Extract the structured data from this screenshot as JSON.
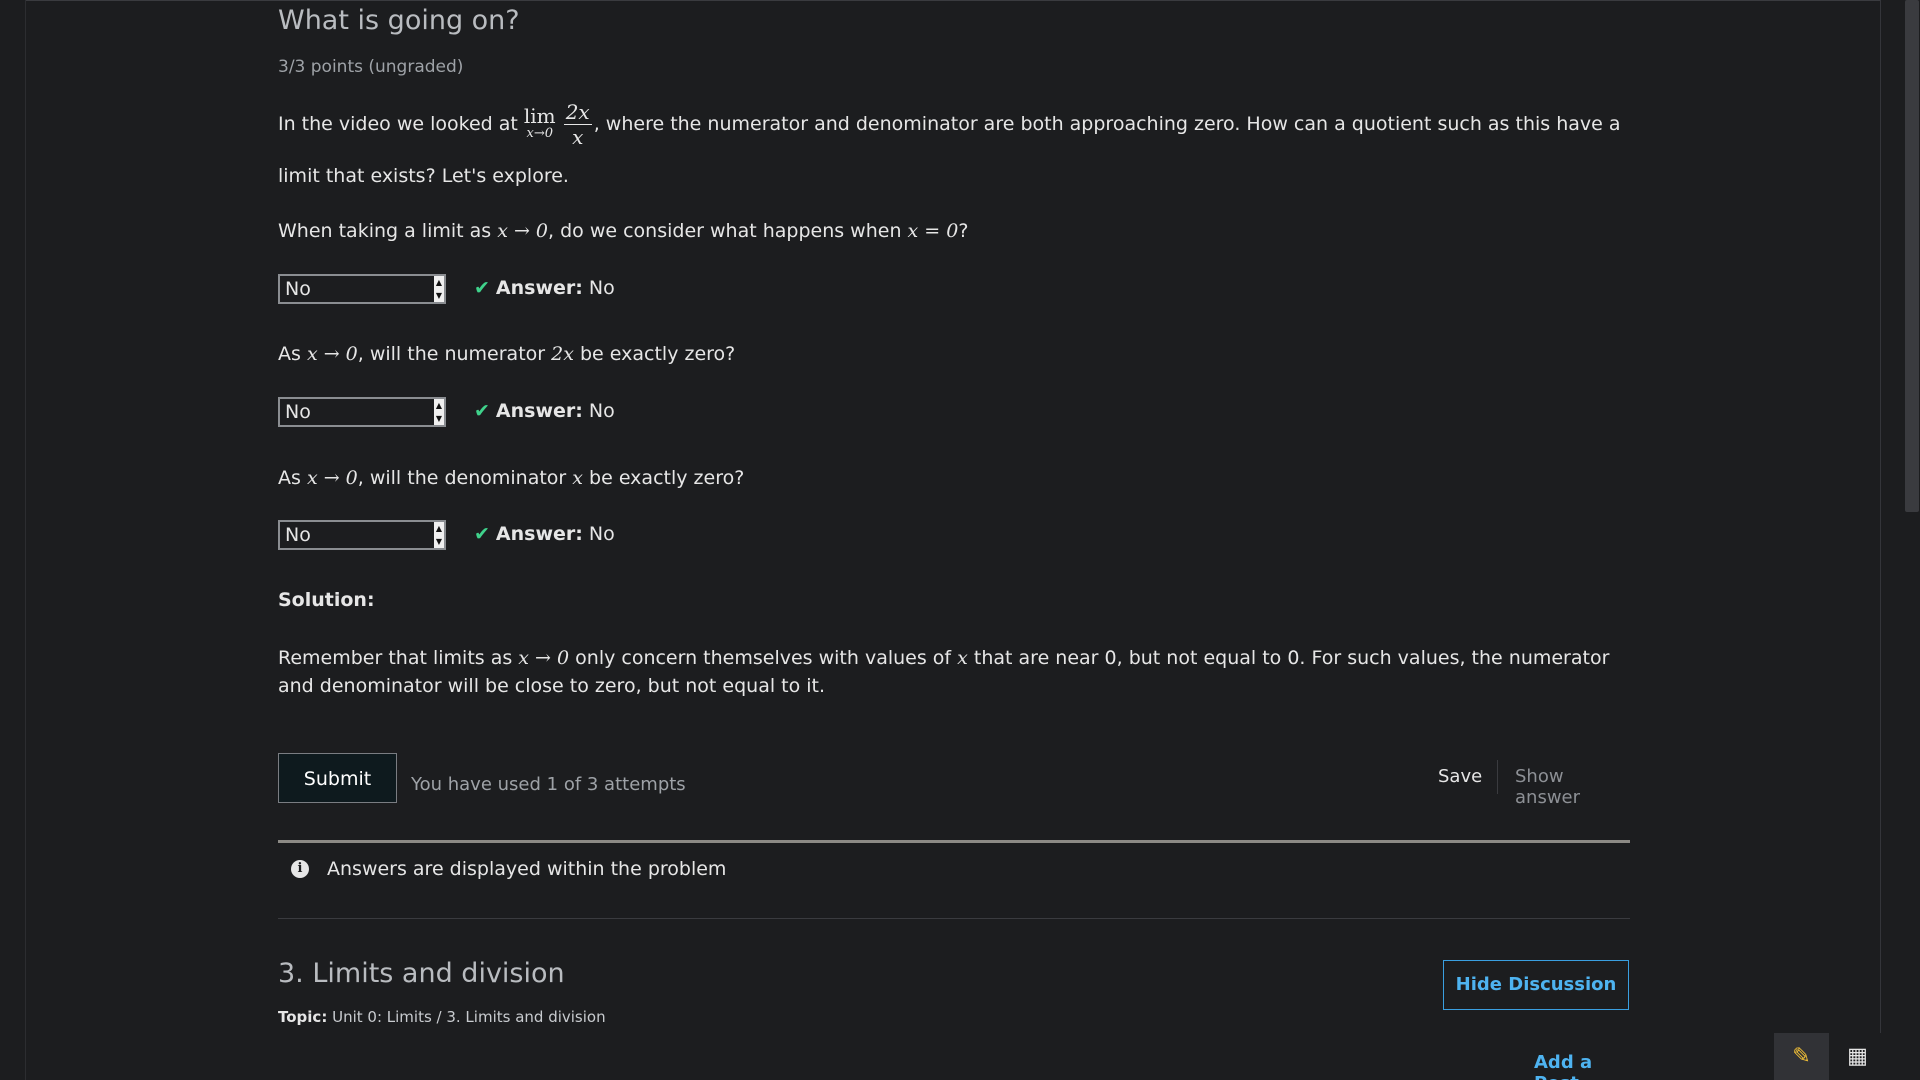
{
  "problem": {
    "title": "What is going on?",
    "points": "3/3 points (ungraded)",
    "intro_before": "In the video we looked at ",
    "intro_lim": "lim",
    "intro_lim_sub": "x→0",
    "intro_frac_num": "2x",
    "intro_frac_den": "x",
    "intro_after": ", where the numerator and denominator are both approaching zero. How can a quotient such as this have a",
    "intro_line2": "limit that exists? Let's explore.",
    "questions": [
      {
        "pre": "When taking a limit as ",
        "math1": "x → 0",
        "mid": ", do we consider what happens when ",
        "math2": "x = 0",
        "post": "?",
        "selected": "No",
        "answer_label": "Answer:",
        "answer_value": "No"
      },
      {
        "pre": "As ",
        "math1": "x → 0",
        "mid": ", will the numerator ",
        "math2": "2x",
        "post": " be exactly zero?",
        "selected": "No",
        "answer_label": "Answer:",
        "answer_value": "No"
      },
      {
        "pre": "As ",
        "math1": "x → 0",
        "mid": ", will the denominator ",
        "math2": "x",
        "post": " be exactly zero?",
        "selected": "No",
        "answer_label": "Answer:",
        "answer_value": "No"
      }
    ],
    "solution_label": "Solution:",
    "solution_pre": "Remember that limits as ",
    "solution_math1": "x → 0",
    "solution_mid": " only concern themselves with values of ",
    "solution_math2": "x",
    "solution_post": " that are near 0, but not equal to 0. For such values, the numerator",
    "solution_line2": "and denominator will be close to zero, but not equal to it."
  },
  "actions": {
    "submit_label": "Submit",
    "attempts_text": "You have used 1 of 3 attempts",
    "save_label": "Save",
    "show_answer_label": "Show answer"
  },
  "notice": {
    "icon": "info-icon",
    "text": "Answers are displayed within the problem"
  },
  "section": {
    "title": "3. Limits and division",
    "topic_label": "Topic:",
    "topic_value": " Unit 0: Limits / 3. Limits and division",
    "hide_discussion_label": "Hide Discussion",
    "add_post_label": "Add a Post"
  },
  "tools": {
    "pencil_icon": "pencil-icon",
    "calculator_icon": "calculator-icon"
  },
  "colors": {
    "background": "#1c1d1f",
    "check": "#3fd28b",
    "link": "#4eb3f0",
    "pencil": "#f2c037"
  }
}
